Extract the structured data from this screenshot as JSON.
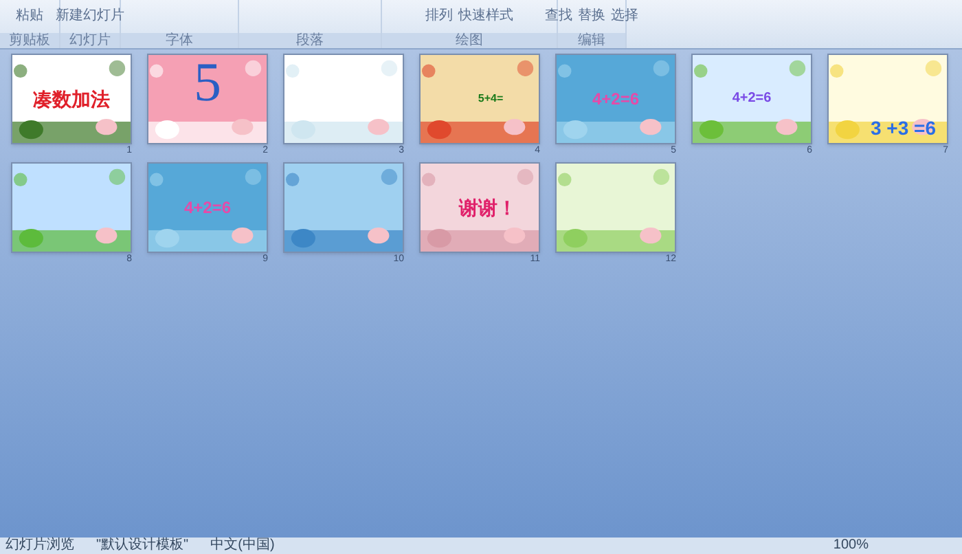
{
  "ribbon": {
    "groups": [
      {
        "label": "剪贴板",
        "buttons": [
          "粘贴"
        ]
      },
      {
        "label": "幻灯片",
        "buttons": [
          "新建幻灯片"
        ]
      },
      {
        "label": "字体"
      },
      {
        "label": "段落"
      },
      {
        "label": "绘图",
        "buttons": [
          "排列",
          "快速样式"
        ]
      },
      {
        "label": "编辑",
        "buttons": [
          "查找",
          "替换",
          "选择"
        ]
      }
    ]
  },
  "slides": [
    {
      "number": "1",
      "kind": "tree",
      "text": "凑数加法"
    },
    {
      "number": "2",
      "kind": "pink",
      "text": "5"
    },
    {
      "number": "3",
      "kind": "white"
    },
    {
      "number": "4",
      "kind": "tan",
      "text": "5+4="
    },
    {
      "number": "5",
      "kind": "sky",
      "text": "4+2=6"
    },
    {
      "number": "6",
      "kind": "meadow",
      "text": "4+2=6"
    },
    {
      "number": "7",
      "kind": "chicks",
      "text": "3 +3 =6"
    },
    {
      "number": "8",
      "kind": "field"
    },
    {
      "number": "9",
      "kind": "sky",
      "text": "4+2=6"
    },
    {
      "number": "10",
      "kind": "ocean"
    },
    {
      "number": "11",
      "kind": "rose",
      "text": "谢谢！"
    },
    {
      "number": "12",
      "kind": "leaf"
    }
  ],
  "status_bar": {
    "view": "幻灯片浏览",
    "theme": "\"默认设计模板\"",
    "language": "中文(中国)",
    "zoom": "100%"
  }
}
